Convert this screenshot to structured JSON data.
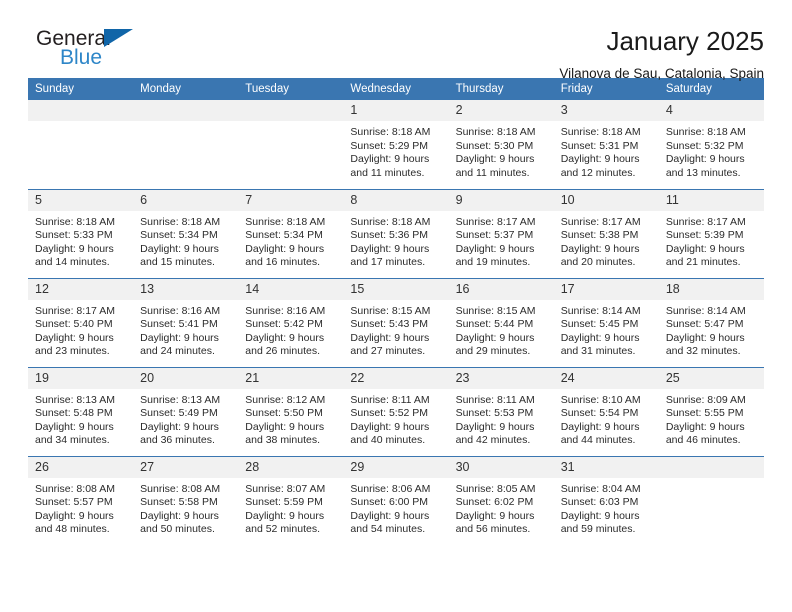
{
  "branding": {
    "name_top": "General",
    "name_bottom": "Blue",
    "triangle_color": "#1065a8",
    "blue_text_color": "#2e86c8"
  },
  "header": {
    "title": "January 2025",
    "subtitle": "Vilanova de Sau, Catalonia, Spain"
  },
  "theme": {
    "header_blue": "#3a76b1",
    "daynum_band": "#f1f1f1",
    "text": "#2b2b2b"
  },
  "weekdays": [
    "Sunday",
    "Monday",
    "Tuesday",
    "Wednesday",
    "Thursday",
    "Friday",
    "Saturday"
  ],
  "weeks": [
    [
      {
        "day": ""
      },
      {
        "day": ""
      },
      {
        "day": ""
      },
      {
        "day": "1",
        "sunrise": "Sunrise: 8:18 AM",
        "sunset": "Sunset: 5:29 PM",
        "daylight1": "Daylight: 9 hours",
        "daylight2": "and 11 minutes."
      },
      {
        "day": "2",
        "sunrise": "Sunrise: 8:18 AM",
        "sunset": "Sunset: 5:30 PM",
        "daylight1": "Daylight: 9 hours",
        "daylight2": "and 11 minutes."
      },
      {
        "day": "3",
        "sunrise": "Sunrise: 8:18 AM",
        "sunset": "Sunset: 5:31 PM",
        "daylight1": "Daylight: 9 hours",
        "daylight2": "and 12 minutes."
      },
      {
        "day": "4",
        "sunrise": "Sunrise: 8:18 AM",
        "sunset": "Sunset: 5:32 PM",
        "daylight1": "Daylight: 9 hours",
        "daylight2": "and 13 minutes."
      }
    ],
    [
      {
        "day": "5",
        "sunrise": "Sunrise: 8:18 AM",
        "sunset": "Sunset: 5:33 PM",
        "daylight1": "Daylight: 9 hours",
        "daylight2": "and 14 minutes."
      },
      {
        "day": "6",
        "sunrise": "Sunrise: 8:18 AM",
        "sunset": "Sunset: 5:34 PM",
        "daylight1": "Daylight: 9 hours",
        "daylight2": "and 15 minutes."
      },
      {
        "day": "7",
        "sunrise": "Sunrise: 8:18 AM",
        "sunset": "Sunset: 5:34 PM",
        "daylight1": "Daylight: 9 hours",
        "daylight2": "and 16 minutes."
      },
      {
        "day": "8",
        "sunrise": "Sunrise: 8:18 AM",
        "sunset": "Sunset: 5:36 PM",
        "daylight1": "Daylight: 9 hours",
        "daylight2": "and 17 minutes."
      },
      {
        "day": "9",
        "sunrise": "Sunrise: 8:17 AM",
        "sunset": "Sunset: 5:37 PM",
        "daylight1": "Daylight: 9 hours",
        "daylight2": "and 19 minutes."
      },
      {
        "day": "10",
        "sunrise": "Sunrise: 8:17 AM",
        "sunset": "Sunset: 5:38 PM",
        "daylight1": "Daylight: 9 hours",
        "daylight2": "and 20 minutes."
      },
      {
        "day": "11",
        "sunrise": "Sunrise: 8:17 AM",
        "sunset": "Sunset: 5:39 PM",
        "daylight1": "Daylight: 9 hours",
        "daylight2": "and 21 minutes."
      }
    ],
    [
      {
        "day": "12",
        "sunrise": "Sunrise: 8:17 AM",
        "sunset": "Sunset: 5:40 PM",
        "daylight1": "Daylight: 9 hours",
        "daylight2": "and 23 minutes."
      },
      {
        "day": "13",
        "sunrise": "Sunrise: 8:16 AM",
        "sunset": "Sunset: 5:41 PM",
        "daylight1": "Daylight: 9 hours",
        "daylight2": "and 24 minutes."
      },
      {
        "day": "14",
        "sunrise": "Sunrise: 8:16 AM",
        "sunset": "Sunset: 5:42 PM",
        "daylight1": "Daylight: 9 hours",
        "daylight2": "and 26 minutes."
      },
      {
        "day": "15",
        "sunrise": "Sunrise: 8:15 AM",
        "sunset": "Sunset: 5:43 PM",
        "daylight1": "Daylight: 9 hours",
        "daylight2": "and 27 minutes."
      },
      {
        "day": "16",
        "sunrise": "Sunrise: 8:15 AM",
        "sunset": "Sunset: 5:44 PM",
        "daylight1": "Daylight: 9 hours",
        "daylight2": "and 29 minutes."
      },
      {
        "day": "17",
        "sunrise": "Sunrise: 8:14 AM",
        "sunset": "Sunset: 5:45 PM",
        "daylight1": "Daylight: 9 hours",
        "daylight2": "and 31 minutes."
      },
      {
        "day": "18",
        "sunrise": "Sunrise: 8:14 AM",
        "sunset": "Sunset: 5:47 PM",
        "daylight1": "Daylight: 9 hours",
        "daylight2": "and 32 minutes."
      }
    ],
    [
      {
        "day": "19",
        "sunrise": "Sunrise: 8:13 AM",
        "sunset": "Sunset: 5:48 PM",
        "daylight1": "Daylight: 9 hours",
        "daylight2": "and 34 minutes."
      },
      {
        "day": "20",
        "sunrise": "Sunrise: 8:13 AM",
        "sunset": "Sunset: 5:49 PM",
        "daylight1": "Daylight: 9 hours",
        "daylight2": "and 36 minutes."
      },
      {
        "day": "21",
        "sunrise": "Sunrise: 8:12 AM",
        "sunset": "Sunset: 5:50 PM",
        "daylight1": "Daylight: 9 hours",
        "daylight2": "and 38 minutes."
      },
      {
        "day": "22",
        "sunrise": "Sunrise: 8:11 AM",
        "sunset": "Sunset: 5:52 PM",
        "daylight1": "Daylight: 9 hours",
        "daylight2": "and 40 minutes."
      },
      {
        "day": "23",
        "sunrise": "Sunrise: 8:11 AM",
        "sunset": "Sunset: 5:53 PM",
        "daylight1": "Daylight: 9 hours",
        "daylight2": "and 42 minutes."
      },
      {
        "day": "24",
        "sunrise": "Sunrise: 8:10 AM",
        "sunset": "Sunset: 5:54 PM",
        "daylight1": "Daylight: 9 hours",
        "daylight2": "and 44 minutes."
      },
      {
        "day": "25",
        "sunrise": "Sunrise: 8:09 AM",
        "sunset": "Sunset: 5:55 PM",
        "daylight1": "Daylight: 9 hours",
        "daylight2": "and 46 minutes."
      }
    ],
    [
      {
        "day": "26",
        "sunrise": "Sunrise: 8:08 AM",
        "sunset": "Sunset: 5:57 PM",
        "daylight1": "Daylight: 9 hours",
        "daylight2": "and 48 minutes."
      },
      {
        "day": "27",
        "sunrise": "Sunrise: 8:08 AM",
        "sunset": "Sunset: 5:58 PM",
        "daylight1": "Daylight: 9 hours",
        "daylight2": "and 50 minutes."
      },
      {
        "day": "28",
        "sunrise": "Sunrise: 8:07 AM",
        "sunset": "Sunset: 5:59 PM",
        "daylight1": "Daylight: 9 hours",
        "daylight2": "and 52 minutes."
      },
      {
        "day": "29",
        "sunrise": "Sunrise: 8:06 AM",
        "sunset": "Sunset: 6:00 PM",
        "daylight1": "Daylight: 9 hours",
        "daylight2": "and 54 minutes."
      },
      {
        "day": "30",
        "sunrise": "Sunrise: 8:05 AM",
        "sunset": "Sunset: 6:02 PM",
        "daylight1": "Daylight: 9 hours",
        "daylight2": "and 56 minutes."
      },
      {
        "day": "31",
        "sunrise": "Sunrise: 8:04 AM",
        "sunset": "Sunset: 6:03 PM",
        "daylight1": "Daylight: 9 hours",
        "daylight2": "and 59 minutes."
      },
      {
        "day": ""
      }
    ]
  ]
}
